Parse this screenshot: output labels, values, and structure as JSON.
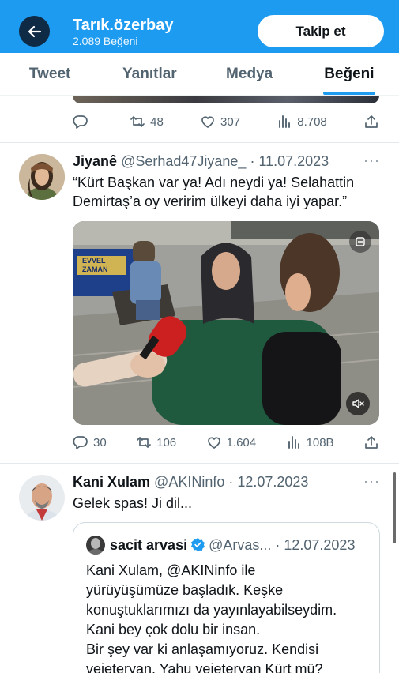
{
  "header": {
    "name": "Tarık.özerbay",
    "subtitle": "2.089 Beğeni",
    "follow_label": "Takip et"
  },
  "tabs": [
    {
      "label": "Tweet",
      "active": false
    },
    {
      "label": "Yanıtlar",
      "active": false
    },
    {
      "label": "Medya",
      "active": false
    },
    {
      "label": "Beğeni",
      "active": true
    }
  ],
  "prev_tweet": {
    "replies": "",
    "retweets": "48",
    "likes": "307",
    "views": "8.708"
  },
  "tweet1": {
    "name": "Jiyanê",
    "handle": "@Serhad47Jiyane_ · 11.07.2023",
    "more": "···",
    "text": "“Kürt Başkan var ya! Adı neydi ya! Selahattin Demirtaş’a oy veririm ülkeyi daha iyi yapar.”",
    "video_sign": "EVVEL ZAMAN",
    "replies": "30",
    "retweets": "106",
    "likes": "1.604",
    "views": "108B"
  },
  "tweet2": {
    "name": "Kani Xulam",
    "handle": "@AKINinfo · 12.07.2023",
    "more": "···",
    "text": "Gelek spas! Ji dil...",
    "quote": {
      "name": "sacit arvasi",
      "handle": "@Arvas... · 12.07.2023",
      "text": "Kani Xulam, @AKINinfo ile\nyürüyüşümüze başladık.  Keşke\nkonuştuklarımızı da yayınlayabilseydim.\nKani bey çok dolu bir insan.\nBir şey var ki anlaşamıyoruz. Kendisi\nvejeteryan. Yahu vejeteryan Kürt mü?"
    }
  },
  "colors": {
    "accent": "#1d9bf0",
    "verified": "#1d9bf0",
    "secondary_text": "#536471"
  }
}
